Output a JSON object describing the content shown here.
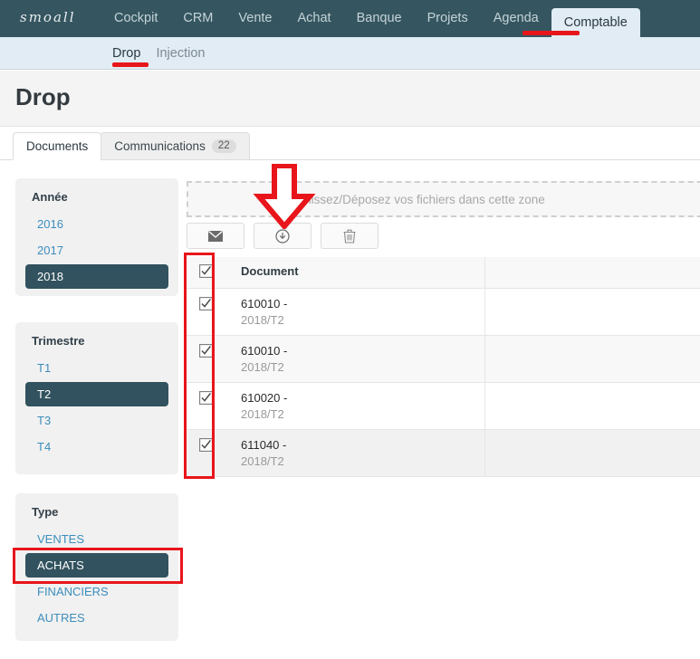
{
  "brand": {
    "name": "smoall"
  },
  "navbar": {
    "items": [
      {
        "label": "Cockpit",
        "active": false
      },
      {
        "label": "CRM",
        "active": false
      },
      {
        "label": "Vente",
        "active": false
      },
      {
        "label": "Achat",
        "active": false
      },
      {
        "label": "Banque",
        "active": false
      },
      {
        "label": "Projets",
        "active": false
      },
      {
        "label": "Agenda",
        "active": false
      },
      {
        "label": "Comptable",
        "active": true
      }
    ],
    "background": "#355660"
  },
  "subnav": {
    "items": [
      {
        "label": "Drop",
        "active": true
      },
      {
        "label": "Injection",
        "active": false
      }
    ],
    "background": "#e1ecf4"
  },
  "page": {
    "title": "Drop"
  },
  "tabs": [
    {
      "label": "Documents",
      "badge": "",
      "active": true
    },
    {
      "label": "Communications",
      "badge": "22",
      "active": false
    }
  ],
  "filters": [
    {
      "title": "Année",
      "options": [
        {
          "label": "2016",
          "selected": false
        },
        {
          "label": "2017",
          "selected": false
        },
        {
          "label": "2018",
          "selected": true
        }
      ]
    },
    {
      "title": "Trimestre",
      "options": [
        {
          "label": "T1",
          "selected": false
        },
        {
          "label": "T2",
          "selected": true
        },
        {
          "label": "T3",
          "selected": false
        },
        {
          "label": "T4",
          "selected": false
        }
      ]
    },
    {
      "title": "Type",
      "options": [
        {
          "label": "VENTES",
          "selected": false
        },
        {
          "label": "ACHATS",
          "selected": true
        },
        {
          "label": "FINANCIERS",
          "selected": false
        },
        {
          "label": "AUTRES",
          "selected": false
        }
      ]
    }
  ],
  "dropzone": {
    "text": "Glissez/Déposez vos fichiers dans cette zone"
  },
  "toolbar": {
    "buttons": [
      {
        "icon": "envelope-icon",
        "name": "send-mail-button"
      },
      {
        "icon": "download-circle-icon",
        "name": "download-button"
      },
      {
        "icon": "trash-icon",
        "name": "delete-button"
      }
    ]
  },
  "table": {
    "header_checkbox_checked": true,
    "columns": [
      "",
      "Document",
      ""
    ],
    "rows": [
      {
        "checked": true,
        "code": "610010 -",
        "sub": "2018/T2"
      },
      {
        "checked": true,
        "code": "610010 -",
        "sub": "2018/T2"
      },
      {
        "checked": true,
        "code": "610020 -",
        "sub": "2018/T2"
      },
      {
        "checked": true,
        "code": "611040 -",
        "sub": "2018/T2"
      }
    ]
  },
  "annotations": {
    "color": "#e8151b",
    "items": [
      {
        "name": "underline-comptable",
        "shape": "line"
      },
      {
        "name": "underline-drop",
        "shape": "line"
      },
      {
        "name": "box-checkbox-column",
        "shape": "box"
      },
      {
        "name": "box-achats-filter",
        "shape": "box"
      },
      {
        "name": "arrow-download-button",
        "shape": "arrow"
      }
    ]
  },
  "colors": {
    "navbar": "#355660",
    "subnav": "#e1ecf4",
    "selected_filter": "#31525e",
    "link": "#3c8dbc",
    "annotation": "#e8151b"
  }
}
